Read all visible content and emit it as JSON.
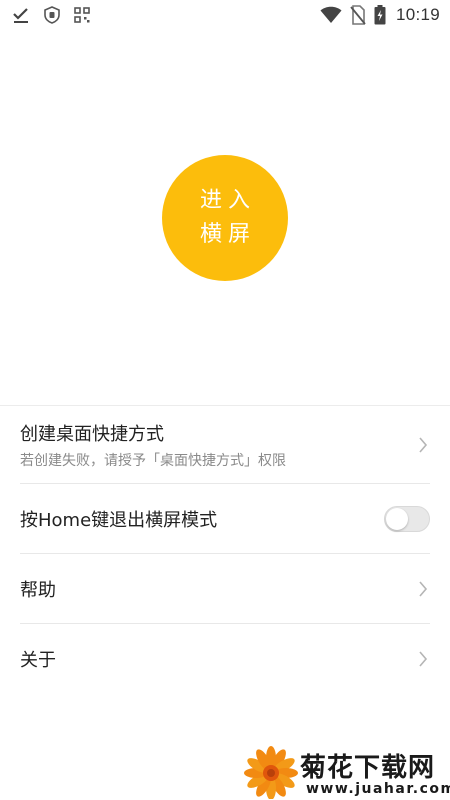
{
  "status_bar": {
    "time": "10:19",
    "left_icons": [
      "download-done-icon",
      "shield-icon",
      "qr-code-icon"
    ],
    "right_icons": [
      "wifi-icon",
      "no-sim-icon",
      "battery-charging-icon"
    ]
  },
  "enter_button": {
    "label": "进入横屏",
    "color": "#fcbd0c"
  },
  "settings": {
    "shortcut": {
      "title": "创建桌面快捷方式",
      "subtitle": "若创建失败，请授予「桌面快捷方式」权限"
    },
    "home_exit": {
      "title": "按Home键退出横屏模式",
      "toggle_on": false
    },
    "help": {
      "title": "帮助"
    },
    "about": {
      "title": "关于"
    }
  },
  "watermark": {
    "title": "菊花下载网",
    "url": "www.juahar.com"
  }
}
